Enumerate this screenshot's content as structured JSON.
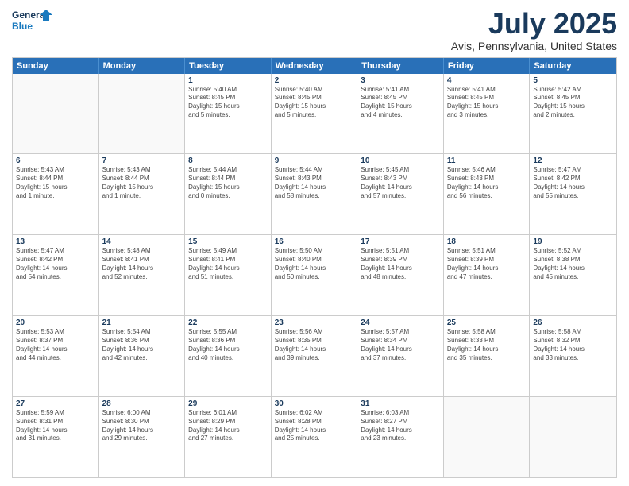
{
  "logo": {
    "line1": "General",
    "line2": "Blue"
  },
  "title": "July 2025",
  "subtitle": "Avis, Pennsylvania, United States",
  "days_of_week": [
    "Sunday",
    "Monday",
    "Tuesday",
    "Wednesday",
    "Thursday",
    "Friday",
    "Saturday"
  ],
  "weeks": [
    [
      {
        "day": "",
        "lines": []
      },
      {
        "day": "",
        "lines": []
      },
      {
        "day": "1",
        "lines": [
          "Sunrise: 5:40 AM",
          "Sunset: 8:45 PM",
          "Daylight: 15 hours",
          "and 5 minutes."
        ]
      },
      {
        "day": "2",
        "lines": [
          "Sunrise: 5:40 AM",
          "Sunset: 8:45 PM",
          "Daylight: 15 hours",
          "and 5 minutes."
        ]
      },
      {
        "day": "3",
        "lines": [
          "Sunrise: 5:41 AM",
          "Sunset: 8:45 PM",
          "Daylight: 15 hours",
          "and 4 minutes."
        ]
      },
      {
        "day": "4",
        "lines": [
          "Sunrise: 5:41 AM",
          "Sunset: 8:45 PM",
          "Daylight: 15 hours",
          "and 3 minutes."
        ]
      },
      {
        "day": "5",
        "lines": [
          "Sunrise: 5:42 AM",
          "Sunset: 8:45 PM",
          "Daylight: 15 hours",
          "and 2 minutes."
        ]
      }
    ],
    [
      {
        "day": "6",
        "lines": [
          "Sunrise: 5:43 AM",
          "Sunset: 8:44 PM",
          "Daylight: 15 hours",
          "and 1 minute."
        ]
      },
      {
        "day": "7",
        "lines": [
          "Sunrise: 5:43 AM",
          "Sunset: 8:44 PM",
          "Daylight: 15 hours",
          "and 1 minute."
        ]
      },
      {
        "day": "8",
        "lines": [
          "Sunrise: 5:44 AM",
          "Sunset: 8:44 PM",
          "Daylight: 15 hours",
          "and 0 minutes."
        ]
      },
      {
        "day": "9",
        "lines": [
          "Sunrise: 5:44 AM",
          "Sunset: 8:43 PM",
          "Daylight: 14 hours",
          "and 58 minutes."
        ]
      },
      {
        "day": "10",
        "lines": [
          "Sunrise: 5:45 AM",
          "Sunset: 8:43 PM",
          "Daylight: 14 hours",
          "and 57 minutes."
        ]
      },
      {
        "day": "11",
        "lines": [
          "Sunrise: 5:46 AM",
          "Sunset: 8:43 PM",
          "Daylight: 14 hours",
          "and 56 minutes."
        ]
      },
      {
        "day": "12",
        "lines": [
          "Sunrise: 5:47 AM",
          "Sunset: 8:42 PM",
          "Daylight: 14 hours",
          "and 55 minutes."
        ]
      }
    ],
    [
      {
        "day": "13",
        "lines": [
          "Sunrise: 5:47 AM",
          "Sunset: 8:42 PM",
          "Daylight: 14 hours",
          "and 54 minutes."
        ]
      },
      {
        "day": "14",
        "lines": [
          "Sunrise: 5:48 AM",
          "Sunset: 8:41 PM",
          "Daylight: 14 hours",
          "and 52 minutes."
        ]
      },
      {
        "day": "15",
        "lines": [
          "Sunrise: 5:49 AM",
          "Sunset: 8:41 PM",
          "Daylight: 14 hours",
          "and 51 minutes."
        ]
      },
      {
        "day": "16",
        "lines": [
          "Sunrise: 5:50 AM",
          "Sunset: 8:40 PM",
          "Daylight: 14 hours",
          "and 50 minutes."
        ]
      },
      {
        "day": "17",
        "lines": [
          "Sunrise: 5:51 AM",
          "Sunset: 8:39 PM",
          "Daylight: 14 hours",
          "and 48 minutes."
        ]
      },
      {
        "day": "18",
        "lines": [
          "Sunrise: 5:51 AM",
          "Sunset: 8:39 PM",
          "Daylight: 14 hours",
          "and 47 minutes."
        ]
      },
      {
        "day": "19",
        "lines": [
          "Sunrise: 5:52 AM",
          "Sunset: 8:38 PM",
          "Daylight: 14 hours",
          "and 45 minutes."
        ]
      }
    ],
    [
      {
        "day": "20",
        "lines": [
          "Sunrise: 5:53 AM",
          "Sunset: 8:37 PM",
          "Daylight: 14 hours",
          "and 44 minutes."
        ]
      },
      {
        "day": "21",
        "lines": [
          "Sunrise: 5:54 AM",
          "Sunset: 8:36 PM",
          "Daylight: 14 hours",
          "and 42 minutes."
        ]
      },
      {
        "day": "22",
        "lines": [
          "Sunrise: 5:55 AM",
          "Sunset: 8:36 PM",
          "Daylight: 14 hours",
          "and 40 minutes."
        ]
      },
      {
        "day": "23",
        "lines": [
          "Sunrise: 5:56 AM",
          "Sunset: 8:35 PM",
          "Daylight: 14 hours",
          "and 39 minutes."
        ]
      },
      {
        "day": "24",
        "lines": [
          "Sunrise: 5:57 AM",
          "Sunset: 8:34 PM",
          "Daylight: 14 hours",
          "and 37 minutes."
        ]
      },
      {
        "day": "25",
        "lines": [
          "Sunrise: 5:58 AM",
          "Sunset: 8:33 PM",
          "Daylight: 14 hours",
          "and 35 minutes."
        ]
      },
      {
        "day": "26",
        "lines": [
          "Sunrise: 5:58 AM",
          "Sunset: 8:32 PM",
          "Daylight: 14 hours",
          "and 33 minutes."
        ]
      }
    ],
    [
      {
        "day": "27",
        "lines": [
          "Sunrise: 5:59 AM",
          "Sunset: 8:31 PM",
          "Daylight: 14 hours",
          "and 31 minutes."
        ]
      },
      {
        "day": "28",
        "lines": [
          "Sunrise: 6:00 AM",
          "Sunset: 8:30 PM",
          "Daylight: 14 hours",
          "and 29 minutes."
        ]
      },
      {
        "day": "29",
        "lines": [
          "Sunrise: 6:01 AM",
          "Sunset: 8:29 PM",
          "Daylight: 14 hours",
          "and 27 minutes."
        ]
      },
      {
        "day": "30",
        "lines": [
          "Sunrise: 6:02 AM",
          "Sunset: 8:28 PM",
          "Daylight: 14 hours",
          "and 25 minutes."
        ]
      },
      {
        "day": "31",
        "lines": [
          "Sunrise: 6:03 AM",
          "Sunset: 8:27 PM",
          "Daylight: 14 hours",
          "and 23 minutes."
        ]
      },
      {
        "day": "",
        "lines": []
      },
      {
        "day": "",
        "lines": []
      }
    ]
  ]
}
